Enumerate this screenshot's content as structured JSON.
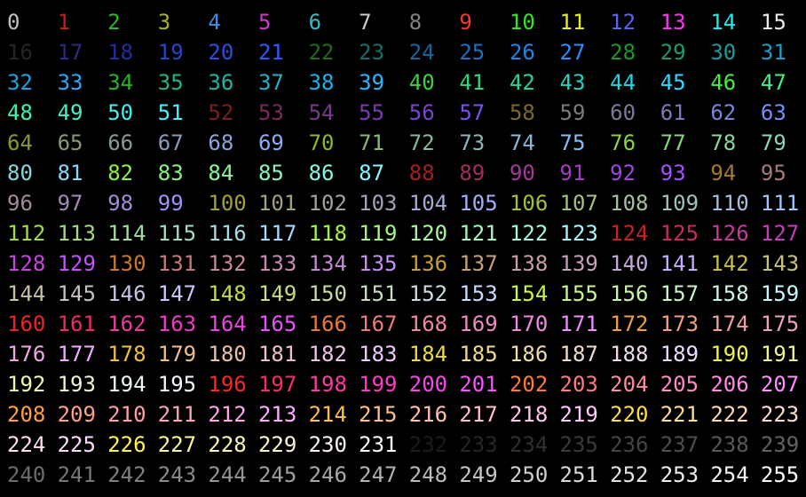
{
  "palette": {
    "title": "",
    "cells": [
      {
        "label": "0",
        "color": "#c0c0c0"
      },
      {
        "label": "1",
        "color": "#c81e14"
      },
      {
        "label": "2",
        "color": "#25bc24"
      },
      {
        "label": "3",
        "color": "#adad27"
      },
      {
        "label": "4",
        "color": "#3b8eea"
      },
      {
        "label": "5",
        "color": "#d338d3"
      },
      {
        "label": "6",
        "color": "#33bbc8"
      },
      {
        "label": "7",
        "color": "#cbcccd"
      },
      {
        "label": "8",
        "color": "#818383"
      },
      {
        "label": "9",
        "color": "#fc391f"
      },
      {
        "label": "10",
        "color": "#31e722"
      },
      {
        "label": "11",
        "color": "#eaec23"
      },
      {
        "label": "12",
        "color": "#5865f2"
      },
      {
        "label": "13",
        "color": "#f935f8"
      },
      {
        "label": "14",
        "color": "#14f0f0"
      },
      {
        "label": "15",
        "color": "#e9ebeb"
      },
      {
        "label": "16",
        "color": "#262626"
      },
      {
        "label": "17",
        "color": "#2a2a87"
      },
      {
        "label": "18",
        "color": "#1f2f9f"
      },
      {
        "label": "19",
        "color": "#2546c8"
      },
      {
        "label": "20",
        "color": "#2a4fe0"
      },
      {
        "label": "21",
        "color": "#3058ff"
      },
      {
        "label": "22",
        "color": "#1e6b1e"
      },
      {
        "label": "23",
        "color": "#1a6b6b"
      },
      {
        "label": "24",
        "color": "#17669a"
      },
      {
        "label": "25",
        "color": "#1c70c2"
      },
      {
        "label": "26",
        "color": "#2184e6"
      },
      {
        "label": "27",
        "color": "#2a90ff"
      },
      {
        "label": "28",
        "color": "#1a9a2a"
      },
      {
        "label": "29",
        "color": "#1a9a70"
      },
      {
        "label": "30",
        "color": "#1a9a9a"
      },
      {
        "label": "31",
        "color": "#1aa0c8"
      },
      {
        "label": "32",
        "color": "#1aa3e0"
      },
      {
        "label": "33",
        "color": "#2aa8ff"
      },
      {
        "label": "34",
        "color": "#28b428"
      },
      {
        "label": "35",
        "color": "#22b48c"
      },
      {
        "label": "36",
        "color": "#1fb4a8"
      },
      {
        "label": "37",
        "color": "#1cb4c8"
      },
      {
        "label": "38",
        "color": "#1ab4e6"
      },
      {
        "label": "39",
        "color": "#28b8ff"
      },
      {
        "label": "40",
        "color": "#37d43a"
      },
      {
        "label": "41",
        "color": "#2fd47a"
      },
      {
        "label": "42",
        "color": "#2ad4a0"
      },
      {
        "label": "43",
        "color": "#25d4c0"
      },
      {
        "label": "44",
        "color": "#22d4e0"
      },
      {
        "label": "45",
        "color": "#2fd8ff"
      },
      {
        "label": "46",
        "color": "#3ef23c"
      },
      {
        "label": "47",
        "color": "#3ef28c"
      },
      {
        "label": "48",
        "color": "#3ef2b0"
      },
      {
        "label": "49",
        "color": "#3ef2d0"
      },
      {
        "label": "50",
        "color": "#3ef2f0"
      },
      {
        "label": "51",
        "color": "#4af4ff"
      },
      {
        "label": "52",
        "color": "#7a1e1e"
      },
      {
        "label": "53",
        "color": "#7a2a5a"
      },
      {
        "label": "54",
        "color": "#7a3a8a"
      },
      {
        "label": "55",
        "color": "#7a3ab0"
      },
      {
        "label": "56",
        "color": "#7a44d0"
      },
      {
        "label": "57",
        "color": "#7a50f0"
      },
      {
        "label": "58",
        "color": "#7a6a2a"
      },
      {
        "label": "59",
        "color": "#7a7a7a"
      },
      {
        "label": "60",
        "color": "#7a7a9a"
      },
      {
        "label": "61",
        "color": "#7a7ab8"
      },
      {
        "label": "62",
        "color": "#7a84d8"
      },
      {
        "label": "63",
        "color": "#7a8ef8"
      },
      {
        "label": "64",
        "color": "#8a9a30"
      },
      {
        "label": "65",
        "color": "#8a9a70"
      },
      {
        "label": "66",
        "color": "#8a9a9a"
      },
      {
        "label": "67",
        "color": "#8a9ab8"
      },
      {
        "label": "68",
        "color": "#8aa4d8"
      },
      {
        "label": "69",
        "color": "#8aaef8"
      },
      {
        "label": "70",
        "color": "#8ab836"
      },
      {
        "label": "71",
        "color": "#8ab876"
      },
      {
        "label": "72",
        "color": "#8ab89a"
      },
      {
        "label": "73",
        "color": "#8ab8b8"
      },
      {
        "label": "74",
        "color": "#8ab8d8"
      },
      {
        "label": "75",
        "color": "#8abcf8"
      },
      {
        "label": "76",
        "color": "#8ad63c"
      },
      {
        "label": "77",
        "color": "#8ad67c"
      },
      {
        "label": "78",
        "color": "#8ad69c"
      },
      {
        "label": "79",
        "color": "#8ad6bc"
      },
      {
        "label": "80",
        "color": "#8ad6dc"
      },
      {
        "label": "81",
        "color": "#8ad6fc"
      },
      {
        "label": "82",
        "color": "#8af43e"
      },
      {
        "label": "83",
        "color": "#8af480"
      },
      {
        "label": "84",
        "color": "#8af4a0"
      },
      {
        "label": "85",
        "color": "#8af4c0"
      },
      {
        "label": "86",
        "color": "#8af4e0"
      },
      {
        "label": "87",
        "color": "#8af4ff"
      },
      {
        "label": "88",
        "color": "#a42020"
      },
      {
        "label": "89",
        "color": "#a42a5e"
      },
      {
        "label": "90",
        "color": "#a43a9a"
      },
      {
        "label": "91",
        "color": "#a43ac0"
      },
      {
        "label": "92",
        "color": "#a444e0"
      },
      {
        "label": "93",
        "color": "#a450ff"
      },
      {
        "label": "94",
        "color": "#a47a30"
      },
      {
        "label": "95",
        "color": "#a47a7a"
      },
      {
        "label": "96",
        "color": "#a48a9a"
      },
      {
        "label": "97",
        "color": "#a48ab8"
      },
      {
        "label": "98",
        "color": "#a48ad8"
      },
      {
        "label": "99",
        "color": "#a48ef8"
      },
      {
        "label": "100",
        "color": "#a4a034"
      },
      {
        "label": "101",
        "color": "#a4a07a"
      },
      {
        "label": "102",
        "color": "#a4a09a"
      },
      {
        "label": "103",
        "color": "#a4a0b8"
      },
      {
        "label": "104",
        "color": "#a4a8d8"
      },
      {
        "label": "105",
        "color": "#a4aef8"
      },
      {
        "label": "106",
        "color": "#a4c038"
      },
      {
        "label": "107",
        "color": "#a4c07c"
      },
      {
        "label": "108",
        "color": "#a4c09c"
      },
      {
        "label": "109",
        "color": "#a4c0bc"
      },
      {
        "label": "110",
        "color": "#a4c0dc"
      },
      {
        "label": "111",
        "color": "#a4c4fc"
      },
      {
        "label": "112",
        "color": "#a4dc3c"
      },
      {
        "label": "113",
        "color": "#a4dc7e"
      },
      {
        "label": "114",
        "color": "#a4dca0"
      },
      {
        "label": "115",
        "color": "#a4dcc0"
      },
      {
        "label": "116",
        "color": "#a4dce0"
      },
      {
        "label": "117",
        "color": "#a4dcff"
      },
      {
        "label": "118",
        "color": "#a4f640"
      },
      {
        "label": "119",
        "color": "#a4f682"
      },
      {
        "label": "120",
        "color": "#a4f6a2"
      },
      {
        "label": "121",
        "color": "#a4f6c2"
      },
      {
        "label": "122",
        "color": "#a4f6e2"
      },
      {
        "label": "123",
        "color": "#a4f6ff"
      },
      {
        "label": "124",
        "color": "#c82222"
      },
      {
        "label": "125",
        "color": "#c82a62"
      },
      {
        "label": "126",
        "color": "#c83a9a"
      },
      {
        "label": "127",
        "color": "#c83ac0"
      },
      {
        "label": "128",
        "color": "#c844e0"
      },
      {
        "label": "129",
        "color": "#c850ff"
      },
      {
        "label": "130",
        "color": "#c87a30"
      },
      {
        "label": "131",
        "color": "#c87a7a"
      },
      {
        "label": "132",
        "color": "#c88a9a"
      },
      {
        "label": "133",
        "color": "#c88ab8"
      },
      {
        "label": "134",
        "color": "#c88ad8"
      },
      {
        "label": "135",
        "color": "#c88ef8"
      },
      {
        "label": "136",
        "color": "#c8a036"
      },
      {
        "label": "137",
        "color": "#c8a07c"
      },
      {
        "label": "138",
        "color": "#c8a09c"
      },
      {
        "label": "139",
        "color": "#c8a0bc"
      },
      {
        "label": "140",
        "color": "#c8a8dc"
      },
      {
        "label": "141",
        "color": "#c8aefc"
      },
      {
        "label": "142",
        "color": "#c8c03a"
      },
      {
        "label": "143",
        "color": "#c8c07e"
      },
      {
        "label": "144",
        "color": "#c8c0a0"
      },
      {
        "label": "145",
        "color": "#c8c0c0"
      },
      {
        "label": "146",
        "color": "#c8c4e0"
      },
      {
        "label": "147",
        "color": "#c8c8ff"
      },
      {
        "label": "148",
        "color": "#c8dc3e"
      },
      {
        "label": "149",
        "color": "#c8dc80"
      },
      {
        "label": "150",
        "color": "#c8dca2"
      },
      {
        "label": "151",
        "color": "#c8dcc2"
      },
      {
        "label": "152",
        "color": "#c8dce2"
      },
      {
        "label": "153",
        "color": "#c8dcff"
      },
      {
        "label": "154",
        "color": "#c8f640"
      },
      {
        "label": "155",
        "color": "#c8f684"
      },
      {
        "label": "156",
        "color": "#c8f6a6"
      },
      {
        "label": "157",
        "color": "#c8f6c6"
      },
      {
        "label": "158",
        "color": "#c8f6e6"
      },
      {
        "label": "159",
        "color": "#c8f6ff"
      },
      {
        "label": "160",
        "color": "#ee2424"
      },
      {
        "label": "161",
        "color": "#ee2a66"
      },
      {
        "label": "162",
        "color": "#ee3a9e"
      },
      {
        "label": "163",
        "color": "#ee3ac4"
      },
      {
        "label": "164",
        "color": "#ee44e4"
      },
      {
        "label": "165",
        "color": "#ee50ff"
      },
      {
        "label": "166",
        "color": "#ee7a34"
      },
      {
        "label": "167",
        "color": "#ee7a80"
      },
      {
        "label": "168",
        "color": "#ee8aa0"
      },
      {
        "label": "169",
        "color": "#ee8ac0"
      },
      {
        "label": "170",
        "color": "#ee8ae0"
      },
      {
        "label": "171",
        "color": "#ee8eff"
      },
      {
        "label": "172",
        "color": "#eea03a"
      },
      {
        "label": "173",
        "color": "#eea084"
      },
      {
        "label": "174",
        "color": "#eea0a4"
      },
      {
        "label": "175",
        "color": "#eea0c4"
      },
      {
        "label": "176",
        "color": "#eea8e4"
      },
      {
        "label": "177",
        "color": "#eeaeff"
      },
      {
        "label": "178",
        "color": "#eec03e"
      },
      {
        "label": "179",
        "color": "#eec088"
      },
      {
        "label": "180",
        "color": "#eec0a8"
      },
      {
        "label": "181",
        "color": "#eec0c8"
      },
      {
        "label": "182",
        "color": "#eec4e8"
      },
      {
        "label": "183",
        "color": "#eec8ff"
      },
      {
        "label": "184",
        "color": "#eedc42"
      },
      {
        "label": "185",
        "color": "#eedc8c"
      },
      {
        "label": "186",
        "color": "#eedcac"
      },
      {
        "label": "187",
        "color": "#eedccc"
      },
      {
        "label": "188",
        "color": "#eedcec"
      },
      {
        "label": "189",
        "color": "#eedcff"
      },
      {
        "label": "190",
        "color": "#eef646"
      },
      {
        "label": "191",
        "color": "#eef690"
      },
      {
        "label": "192",
        "color": "#eef6b0"
      },
      {
        "label": "193",
        "color": "#eef6d0"
      },
      {
        "label": "194",
        "color": "#eef6f0"
      },
      {
        "label": "195",
        "color": "#f4f8ff"
      },
      {
        "label": "196",
        "color": "#ff2626"
      },
      {
        "label": "197",
        "color": "#ff2a6a"
      },
      {
        "label": "198",
        "color": "#ff3aa2"
      },
      {
        "label": "199",
        "color": "#ff3ac8"
      },
      {
        "label": "200",
        "color": "#ff44e8"
      },
      {
        "label": "201",
        "color": "#ff50ff"
      },
      {
        "label": "202",
        "color": "#ff7a38"
      },
      {
        "label": "203",
        "color": "#ff7a84"
      },
      {
        "label": "204",
        "color": "#ff8aa4"
      },
      {
        "label": "205",
        "color": "#ff8ac4"
      },
      {
        "label": "206",
        "color": "#ff8ae4"
      },
      {
        "label": "207",
        "color": "#ff8eff"
      },
      {
        "label": "208",
        "color": "#ffa03e"
      },
      {
        "label": "209",
        "color": "#ffa088"
      },
      {
        "label": "210",
        "color": "#ffa0a8"
      },
      {
        "label": "211",
        "color": "#ffa0c8"
      },
      {
        "label": "212",
        "color": "#ffa8e8"
      },
      {
        "label": "213",
        "color": "#ffaeff"
      },
      {
        "label": "214",
        "color": "#ffc042"
      },
      {
        "label": "215",
        "color": "#ffc08c"
      },
      {
        "label": "216",
        "color": "#ffc0ac"
      },
      {
        "label": "217",
        "color": "#ffc0cc"
      },
      {
        "label": "218",
        "color": "#ffc4ec"
      },
      {
        "label": "219",
        "color": "#ffc8ff"
      },
      {
        "label": "220",
        "color": "#ffdc46"
      },
      {
        "label": "221",
        "color": "#ffdc90"
      },
      {
        "label": "222",
        "color": "#ffdcb0"
      },
      {
        "label": "223",
        "color": "#ffdcd0"
      },
      {
        "label": "224",
        "color": "#ffdcf0"
      },
      {
        "label": "225",
        "color": "#ffdcff"
      },
      {
        "label": "226",
        "color": "#fff64a"
      },
      {
        "label": "227",
        "color": "#fff694"
      },
      {
        "label": "228",
        "color": "#fff6b4"
      },
      {
        "label": "229",
        "color": "#fff6d4"
      },
      {
        "label": "230",
        "color": "#fff6f4"
      },
      {
        "label": "231",
        "color": "#ffffff"
      },
      {
        "label": "232",
        "color": "#1c1c1c"
      },
      {
        "label": "233",
        "color": "#262626"
      },
      {
        "label": "234",
        "color": "#303030"
      },
      {
        "label": "235",
        "color": "#3a3a3a"
      },
      {
        "label": "236",
        "color": "#444444"
      },
      {
        "label": "237",
        "color": "#4e4e4e"
      },
      {
        "label": "238",
        "color": "#585858"
      },
      {
        "label": "239",
        "color": "#626262"
      },
      {
        "label": "240",
        "color": "#6c6c6c"
      },
      {
        "label": "241",
        "color": "#767676"
      },
      {
        "label": "242",
        "color": "#808080"
      },
      {
        "label": "243",
        "color": "#8a8a8a"
      },
      {
        "label": "244",
        "color": "#949494"
      },
      {
        "label": "245",
        "color": "#9e9e9e"
      },
      {
        "label": "246",
        "color": "#a8a8a8"
      },
      {
        "label": "247",
        "color": "#b2b2b2"
      },
      {
        "label": "248",
        "color": "#bcbcbc"
      },
      {
        "label": "249",
        "color": "#c6c6c6"
      },
      {
        "label": "250",
        "color": "#d0d0d0"
      },
      {
        "label": "251",
        "color": "#dadada"
      },
      {
        "label": "252",
        "color": "#e4e4e4"
      },
      {
        "label": "253",
        "color": "#eeeeee"
      },
      {
        "label": "254",
        "color": "#f7f7f7"
      },
      {
        "label": "255",
        "color": "#ffffff"
      }
    ]
  }
}
